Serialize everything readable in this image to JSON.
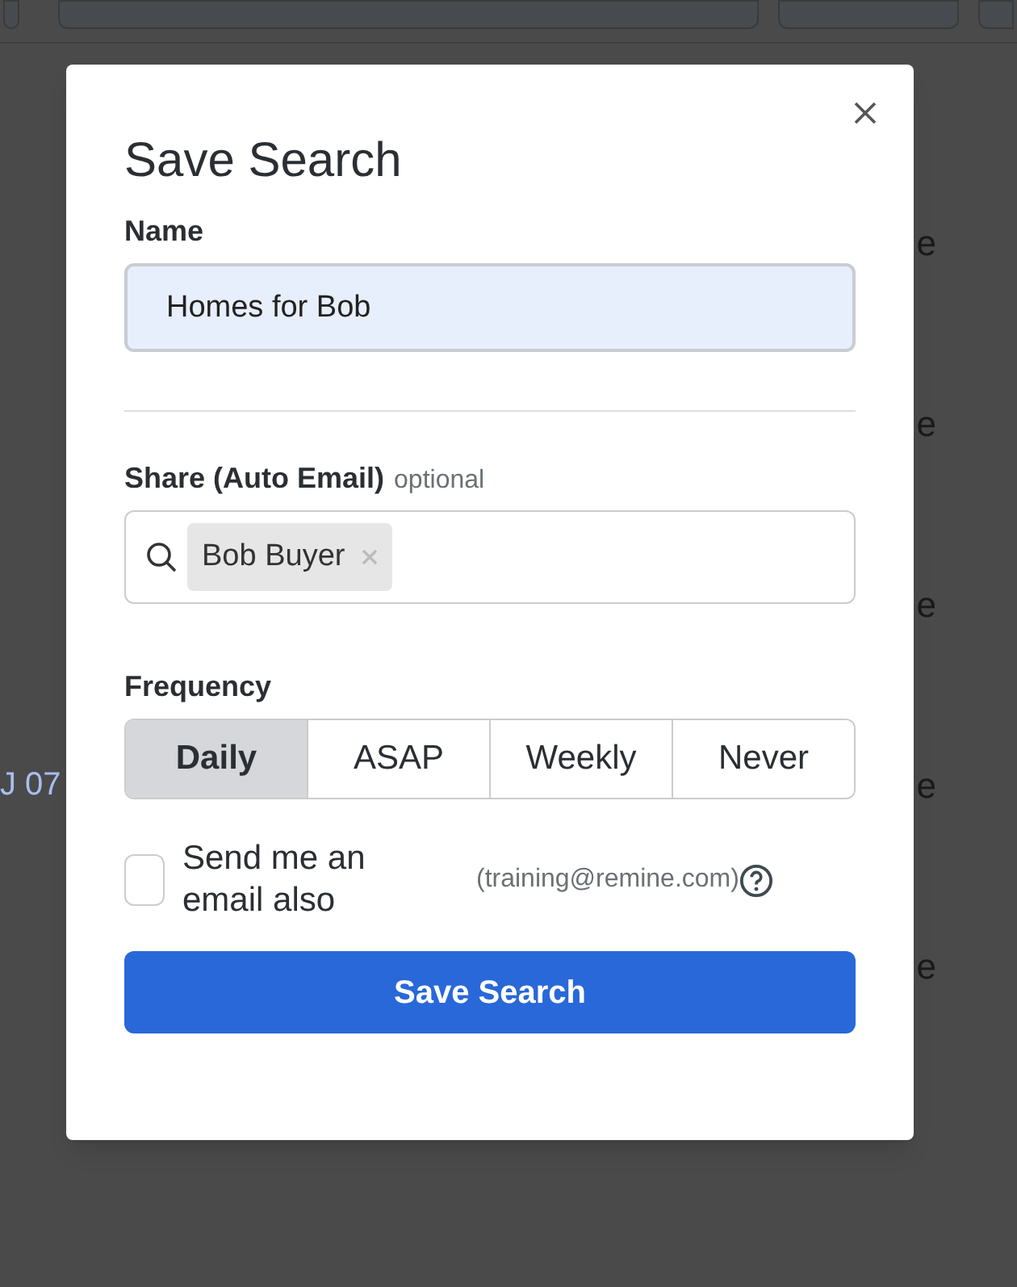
{
  "background": {
    "rows": [
      {
        "left": "",
        "right": "e"
      },
      {
        "left": "",
        "right": "e"
      },
      {
        "left": "",
        "right": "e"
      },
      {
        "left": "J 07",
        "right": "e"
      },
      {
        "left": "",
        "right": "e"
      }
    ]
  },
  "dialog": {
    "title": "Save Search",
    "name_label": "Name",
    "name_value": "Homes for Bob",
    "share_label": "Share (Auto Email)",
    "share_hint": "optional",
    "share_chips": [
      {
        "label": "Bob Buyer"
      }
    ],
    "frequency_label": "Frequency",
    "frequency_options": [
      {
        "label": "Daily",
        "selected": true
      },
      {
        "label": "ASAP",
        "selected": false
      },
      {
        "label": "Weekly",
        "selected": false
      },
      {
        "label": "Never",
        "selected": false
      }
    ],
    "copy_checkbox": {
      "label": "Send me an email also",
      "checked": false,
      "email": "(training@remine.com)"
    },
    "submit": "Save Search"
  }
}
